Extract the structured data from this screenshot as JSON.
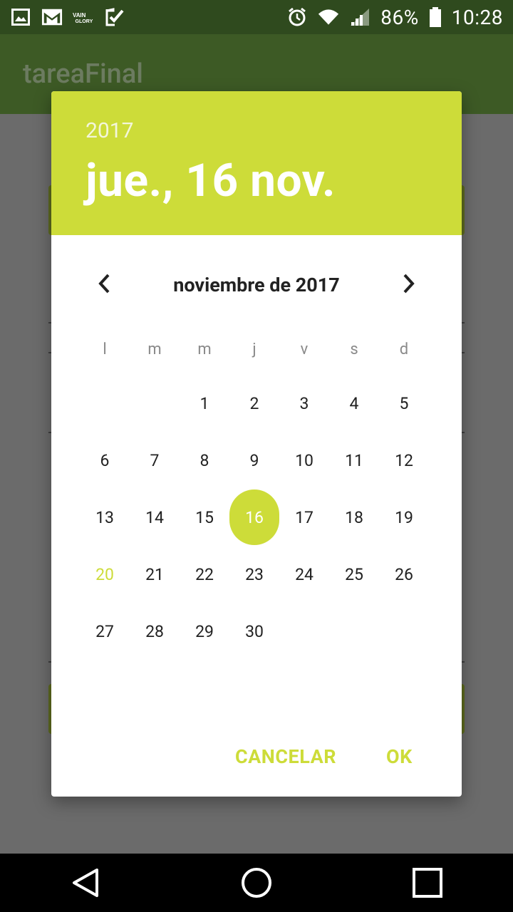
{
  "status_bar": {
    "battery": "86%",
    "time": "10:28",
    "left_icons": [
      "gallery-icon",
      "gmail-icon",
      "vainglory-icon",
      "checkmark-icon"
    ],
    "right_icons": [
      "alarm-icon",
      "wifi-icon",
      "signal-icon",
      "battery-icon"
    ]
  },
  "app_bar": {
    "title": "tareaFinal"
  },
  "dialog": {
    "year": "2017",
    "date_title": "jue., 16 nov.",
    "month_label": "noviembre de 2017",
    "weekdays": [
      "l",
      "m",
      "m",
      "j",
      "v",
      "s",
      "d"
    ],
    "days": [
      {
        "n": "1",
        "col": 2,
        "row": 0
      },
      {
        "n": "2",
        "col": 3,
        "row": 0
      },
      {
        "n": "3",
        "col": 4,
        "row": 0
      },
      {
        "n": "4",
        "col": 5,
        "row": 0
      },
      {
        "n": "5",
        "col": 6,
        "row": 0
      },
      {
        "n": "6",
        "col": 0,
        "row": 1
      },
      {
        "n": "7",
        "col": 1,
        "row": 1
      },
      {
        "n": "8",
        "col": 2,
        "row": 1
      },
      {
        "n": "9",
        "col": 3,
        "row": 1
      },
      {
        "n": "10",
        "col": 4,
        "row": 1
      },
      {
        "n": "11",
        "col": 5,
        "row": 1
      },
      {
        "n": "12",
        "col": 6,
        "row": 1
      },
      {
        "n": "13",
        "col": 0,
        "row": 2
      },
      {
        "n": "14",
        "col": 1,
        "row": 2
      },
      {
        "n": "15",
        "col": 2,
        "row": 2
      },
      {
        "n": "16",
        "col": 3,
        "row": 2,
        "selected": true
      },
      {
        "n": "17",
        "col": 4,
        "row": 2
      },
      {
        "n": "18",
        "col": 5,
        "row": 2
      },
      {
        "n": "19",
        "col": 6,
        "row": 2
      },
      {
        "n": "20",
        "col": 0,
        "row": 3,
        "today": true
      },
      {
        "n": "21",
        "col": 1,
        "row": 3
      },
      {
        "n": "22",
        "col": 2,
        "row": 3
      },
      {
        "n": "23",
        "col": 3,
        "row": 3
      },
      {
        "n": "24",
        "col": 4,
        "row": 3
      },
      {
        "n": "25",
        "col": 5,
        "row": 3
      },
      {
        "n": "26",
        "col": 6,
        "row": 3
      },
      {
        "n": "27",
        "col": 0,
        "row": 4
      },
      {
        "n": "28",
        "col": 1,
        "row": 4
      },
      {
        "n": "29",
        "col": 2,
        "row": 4
      },
      {
        "n": "30",
        "col": 3,
        "row": 4
      }
    ],
    "cancel_label": "CANCELAR",
    "ok_label": "OK"
  },
  "colors": {
    "accent": "#cddc39",
    "status_bar": "#2f4a1e",
    "app_bar": "#3d5a25"
  },
  "nav_bar": {
    "icons": [
      "back-icon",
      "home-icon",
      "recents-icon"
    ]
  }
}
